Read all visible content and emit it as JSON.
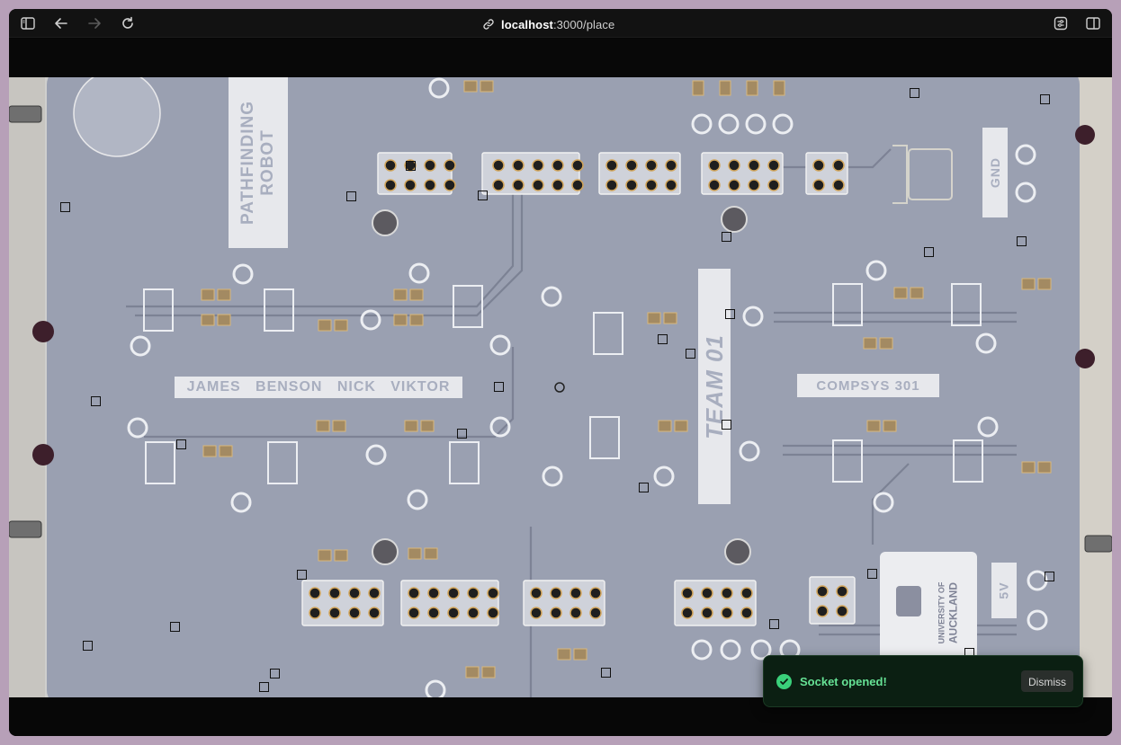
{
  "browser": {
    "url_host": "localhost",
    "url_path": ":3000/place"
  },
  "icons": {
    "sidebar": "sidebar-icon",
    "back": "back-arrow-icon",
    "forward": "forward-arrow-icon",
    "reload": "reload-icon",
    "link": "link-icon",
    "extensions": "extensions-icon",
    "split_view": "split-view-icon",
    "success": "check-circle-icon"
  },
  "pcb": {
    "title_line1": "PATHFINDING",
    "title_line2": "ROBOT",
    "names": "JAMES   BENSON   NICK   VIKTOR",
    "team": "TEAM 01",
    "course": "COMPSYS 301",
    "gnd": "GND",
    "five_v": "5V",
    "uoa_line1": "UNIVERSITY OF",
    "uoa_line2": "AUCKLAND"
  },
  "toast": {
    "message": "Socket opened!",
    "dismiss_label": "Dismiss"
  },
  "colors": {
    "board": "#9aa0b1",
    "toast_bg": "#0b1f12",
    "toast_text": "#66e295",
    "success": "#3ad07a"
  }
}
